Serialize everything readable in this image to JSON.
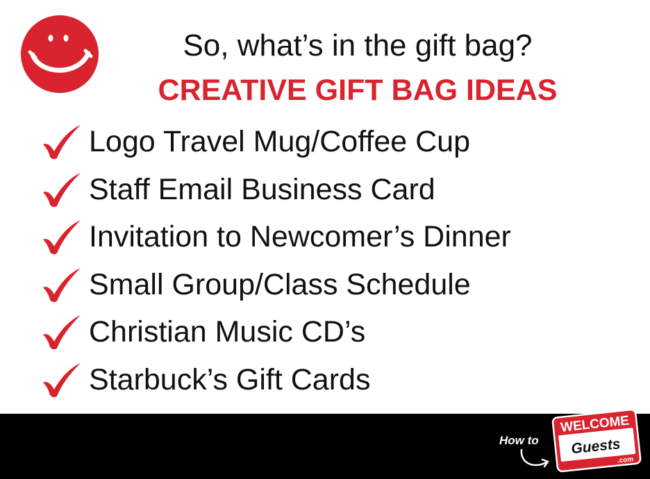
{
  "colors": {
    "accent_red": "#d9232e",
    "text_dark": "#111111",
    "footer_bg": "#000000"
  },
  "header": {
    "question": "So, what’s in the gift bag?",
    "title": "CREATIVE GIFT BAG IDEAS",
    "smiley_icon": "smiley-face-icon"
  },
  "ideas": [
    {
      "icon": "checkmark-icon",
      "label": "Logo Travel Mug/Coffee Cup"
    },
    {
      "icon": "checkmark-icon",
      "label": "Staff Email Business Card"
    },
    {
      "icon": "checkmark-icon",
      "label": "Invitation to Newcomer’s Dinner"
    },
    {
      "icon": "checkmark-icon",
      "label": "Small Group/Class Schedule"
    },
    {
      "icon": "checkmark-icon",
      "label": "Christian Music CD’s"
    },
    {
      "icon": "checkmark-icon",
      "label": "Starbuck’s Gift Cards"
    }
  ],
  "footer": {
    "logo": {
      "prefix": "How to",
      "badge_title": "WELCOME",
      "badge_name": "Guests",
      "badge_suffix": ".com"
    }
  }
}
